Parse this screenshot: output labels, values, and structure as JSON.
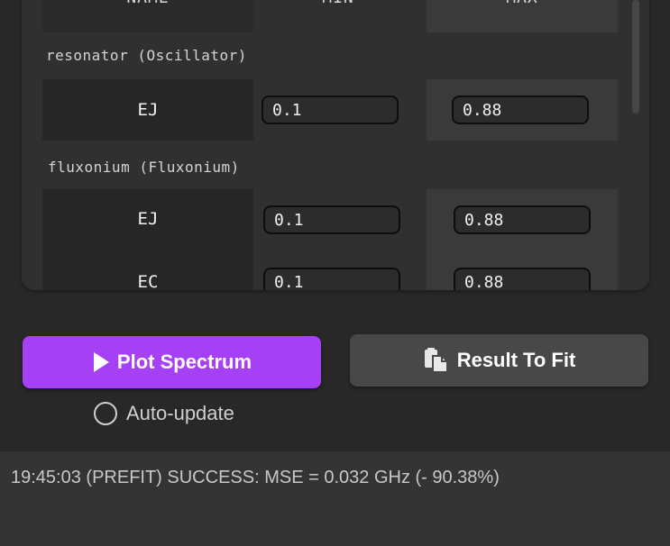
{
  "table": {
    "headers": {
      "name": "NAME",
      "min": "MIN",
      "max": "MAX"
    },
    "groups": [
      {
        "title": "resonator (Oscillator)",
        "rows": [
          {
            "name": "EJ",
            "min": "0.1",
            "max": "0.88"
          }
        ]
      },
      {
        "title": "fluxonium (Fluxonium)",
        "rows": [
          {
            "name": "EJ",
            "min": "0.1",
            "max": "0.88"
          },
          {
            "name": "EC",
            "min": "0.1",
            "max": "0.88"
          }
        ]
      }
    ]
  },
  "buttons": {
    "plot": "Plot Spectrum",
    "result": "Result To Fit"
  },
  "auto_update": {
    "label": "Auto-update",
    "checked": false
  },
  "status": {
    "text": "19:45:03 (PREFIT) SUCCESS: MSE = 0.032 GHz (- 90.38%)"
  },
  "colors": {
    "plot_button": "#a640f5",
    "background": "#282828",
    "panel": "#303030"
  },
  "icons": {
    "plot": "play-icon",
    "result": "clipboard-copy-icon"
  }
}
